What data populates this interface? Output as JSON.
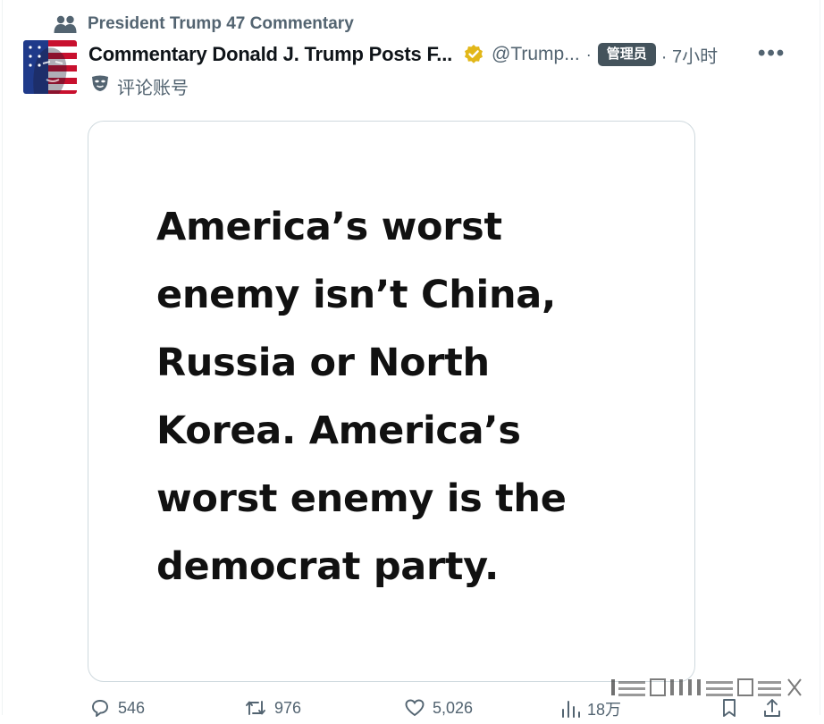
{
  "community": {
    "icon": "people-icon",
    "name": "President Trump 47 Commentary"
  },
  "author": {
    "avatar": "flag-face-avatar",
    "name": "Commentary Donald J. Trump Posts F...",
    "verified_icon": "verified-badge-icon",
    "verified_color": "#e2b719",
    "handle": "@Trump...",
    "separator": "·",
    "role_badge": "管理员",
    "time": "· 7小时",
    "more_icon": "more-icon"
  },
  "account_label": {
    "icon": "mask-icon",
    "text": "评论账号"
  },
  "media": {
    "lines": [
      "America’s worst",
      "enemy isn’t China,",
      "Russia or North",
      "Korea. America’s",
      "worst enemy is the",
      "democrat party."
    ]
  },
  "actions": {
    "reply_count": "546",
    "repost_count": "976",
    "like_count": "5,026",
    "views_count": "18万"
  },
  "colors": {
    "text_primary": "#0f1419",
    "text_secondary": "#536471",
    "badge_bg": "#44535c",
    "border": "#cfd9de"
  }
}
